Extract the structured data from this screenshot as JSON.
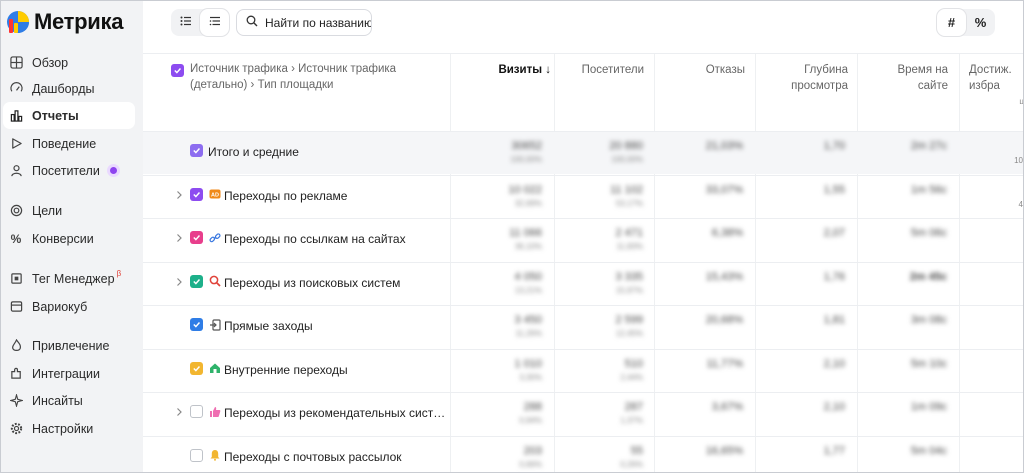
{
  "brand": {
    "name": "Метрика"
  },
  "sidebar": {
    "items": [
      {
        "label": "Обзор",
        "icon": "overview-icon"
      },
      {
        "label": "Дашборды",
        "icon": "dashboard-icon"
      },
      {
        "label": "Отчеты",
        "icon": "reports-icon",
        "active": true
      },
      {
        "label": "Поведение",
        "icon": "behavior-icon"
      },
      {
        "label": "Посетители",
        "icon": "visitors-icon"
      },
      {
        "label": "Цели",
        "icon": "target-icon"
      },
      {
        "label": "Конверсии",
        "icon": "percent-icon"
      },
      {
        "label": "Тег Менеджер",
        "icon": "tag-icon",
        "badge": "β"
      },
      {
        "label": "Вариокуб",
        "icon": "cube-icon"
      },
      {
        "label": "Привлечение",
        "icon": "flame-icon"
      },
      {
        "label": "Интеграции",
        "icon": "puzzle-icon"
      },
      {
        "label": "Инсайты",
        "icon": "sparkle-icon"
      },
      {
        "label": "Настройки",
        "icon": "gear-icon"
      }
    ]
  },
  "toolbar": {
    "search_placeholder": "Найти по названию",
    "absolute_label": "#",
    "percent_label": "%"
  },
  "table": {
    "dimension_header": "Источник трафика › Источник трафика (детально) › Тип площадки",
    "columns": [
      {
        "label": "Визиты ↓",
        "sorted": true
      },
      {
        "label": "Посетители"
      },
      {
        "label": "Отказы"
      },
      {
        "label": "Глубина просмотра"
      },
      {
        "label": "Время на сайте"
      },
      {
        "label": "Достиж. избра"
      }
    ],
    "edge_values": [
      "ц",
      "10",
      "4",
      "",
      "",
      "",
      "",
      ""
    ],
    "rows": [
      {
        "label": "Итого и средние",
        "total": true,
        "color": "#8d6df0",
        "values": [
          [
            "30652",
            "100,00%"
          ],
          [
            "20 880",
            "100,00%"
          ],
          [
            "21,03%",
            ""
          ],
          [
            "1,70",
            ""
          ],
          [
            "2m 27c",
            ""
          ]
        ]
      },
      {
        "label": "Переходы по рекламе",
        "color": "#8d4cf0",
        "icon": "ad-icon",
        "expandable": true,
        "values": [
          [
            "10 022",
            "32,69%"
          ],
          [
            "11 102",
            "53,17%"
          ],
          [
            "33,07%",
            ""
          ],
          [
            "1,55",
            ""
          ],
          [
            "1m 56c",
            ""
          ]
        ]
      },
      {
        "label": "Переходы по ссылкам на сайтах",
        "color": "#e83e8c",
        "icon": "link-icon",
        "expandable": true,
        "values": [
          [
            "11 066",
            "36,10%"
          ],
          [
            "2 471",
            "11,83%"
          ],
          [
            "6,38%",
            ""
          ],
          [
            "2,07",
            ""
          ],
          [
            "5m 06c",
            ""
          ]
        ]
      },
      {
        "label": "Переходы из поисковых систем",
        "color": "#1db08a",
        "icon": "search-engine-icon",
        "expandable": true,
        "values": [
          [
            "4 050",
            "13,21%"
          ],
          [
            "3 335",
            "15,97%"
          ],
          [
            "15,43%",
            ""
          ],
          [
            "1,76",
            ""
          ],
          [
            "2m 45c",
            ""
          ]
        ]
      },
      {
        "label": "Прямые заходы",
        "color": "#2f7de6",
        "icon": "direct-icon",
        "expandable": false,
        "values": [
          [
            "3 450",
            "11,26%"
          ],
          [
            "2 599",
            "12,45%"
          ],
          [
            "20,68%",
            ""
          ],
          [
            "1,81",
            ""
          ],
          [
            "3m 08c",
            ""
          ]
        ]
      },
      {
        "label": "Внутренние переходы",
        "color": "#f2b630",
        "icon": "home-icon",
        "expandable": false,
        "values": [
          [
            "1 010",
            "3,30%"
          ],
          [
            "510",
            "2,44%"
          ],
          [
            "11,77%",
            ""
          ],
          [
            "2,10",
            ""
          ],
          [
            "5m 10c",
            ""
          ]
        ]
      },
      {
        "label": "Переходы из рекомендательных сист…",
        "color": "",
        "icon": "thumb-icon",
        "expandable": true,
        "values": [
          [
            "288",
            "0,94%"
          ],
          [
            "287",
            "1,37%"
          ],
          [
            "3,67%",
            ""
          ],
          [
            "2,10",
            ""
          ],
          [
            "1m 09c",
            ""
          ]
        ]
      },
      {
        "label": "Переходы с почтовых рассылок",
        "color": "",
        "icon": "bell-icon",
        "expandable": false,
        "values": [
          [
            "203",
            "0,66%"
          ],
          [
            "55",
            "0,26%"
          ],
          [
            "16,65%",
            ""
          ],
          [
            "1,77",
            ""
          ],
          [
            "5m 04c",
            ""
          ]
        ]
      }
    ]
  }
}
